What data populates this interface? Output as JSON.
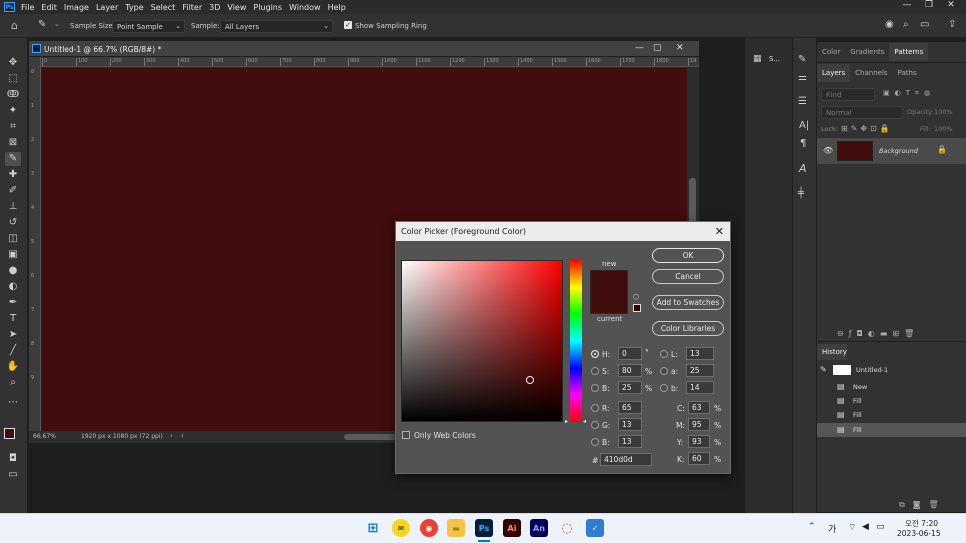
{
  "app": {
    "logo": "Ps",
    "menu": [
      "File",
      "Edit",
      "Image",
      "Layer",
      "Type",
      "Select",
      "Filter",
      "3D",
      "View",
      "Plugins",
      "Window",
      "Help"
    ]
  },
  "options": {
    "sample_size_label": "Sample Size:",
    "sample_size_value": "Point Sample",
    "sample_label": "Sample:",
    "sample_value": "All Layers",
    "show_ring_label": "Show Sampling Ring",
    "show_ring_checked": true
  },
  "document": {
    "tab_title": "Untitled-1 @ 66.7% (RGB/8#) *",
    "ruler_h": [
      "0",
      "100",
      "200",
      "300",
      "400",
      "500",
      "600",
      "700",
      "800",
      "900",
      "1000",
      "1100",
      "1200",
      "1300",
      "1400",
      "1500",
      "1600",
      "1700",
      "1800",
      "19"
    ],
    "ruler_v": [
      "0",
      "1",
      "2",
      "3",
      "4",
      "5",
      "6",
      "7",
      "8",
      "9"
    ],
    "zoom": "66.67%",
    "info": "1920 px x 1080 px (72 ppi)",
    "fill_color": "#410d0d"
  },
  "dialog": {
    "title": "Color Picker (Foreground Color)",
    "new_label": "new",
    "current_label": "current",
    "new_color": "#410d0d",
    "current_color": "#410d0d",
    "buttons": {
      "ok": "OK",
      "cancel": "Cancel",
      "add_swatches": "Add to Swatches",
      "libraries": "Color Libraries"
    },
    "only_web_colors": "Only Web Colors",
    "hsb": [
      {
        "label": "H:",
        "value": "0",
        "unit": "°"
      },
      {
        "label": "S:",
        "value": "80",
        "unit": "%"
      },
      {
        "label": "B:",
        "value": "25",
        "unit": "%"
      }
    ],
    "rgb": [
      {
        "label": "R:",
        "value": "65"
      },
      {
        "label": "G:",
        "value": "13"
      },
      {
        "label": "B:",
        "value": "13"
      }
    ],
    "lab": [
      {
        "label": "L:",
        "value": "13"
      },
      {
        "label": "a:",
        "value": "25"
      },
      {
        "label": "b:",
        "value": "14"
      }
    ],
    "cmyk": [
      {
        "label": "C:",
        "value": "63",
        "unit": "%"
      },
      {
        "label": "M:",
        "value": "95",
        "unit": "%"
      },
      {
        "label": "Y:",
        "value": "93",
        "unit": "%"
      },
      {
        "label": "K:",
        "value": "60",
        "unit": "%"
      }
    ],
    "hex_label": "#",
    "hex_value": "410d0d",
    "selected_mode": "H"
  },
  "side": {
    "mid_label": "S..."
  },
  "panels": {
    "top_tabs": [
      "Color",
      "Gradients",
      "Patterns"
    ],
    "top_active": "Patterns",
    "layer_tabs": [
      "Layers",
      "Channels",
      "Paths"
    ],
    "layer_active": "Layers",
    "kind_placeholder": "Kind",
    "blend": "Normal",
    "opacity_label": "Opacity:",
    "opacity_value": "100%",
    "lock_label": "Lock:",
    "fill_label": "Fill:",
    "fill_value": "100%",
    "layer_name": "Background",
    "history_title": "History",
    "history_doc": "Untitled-1",
    "history_items": [
      "New",
      "Fill",
      "Fill",
      "Fill"
    ]
  },
  "taskbar": {
    "lang": "가",
    "time": "오전 7:20",
    "date": "2023-06-15",
    "apps": [
      "Ps",
      "Ai",
      "An"
    ]
  }
}
